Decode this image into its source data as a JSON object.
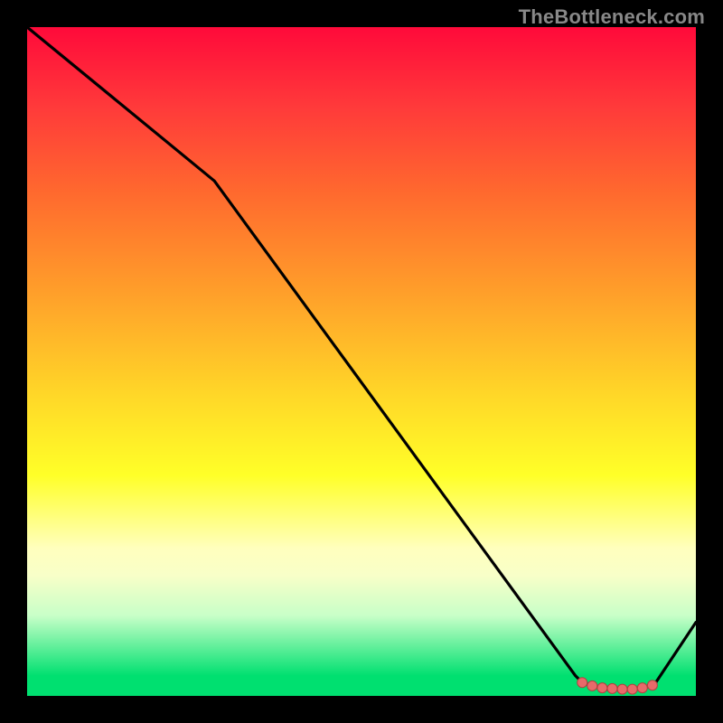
{
  "watermark": "TheBottleneck.com",
  "chart_data": {
    "type": "line",
    "title": "",
    "xlabel": "",
    "ylabel": "",
    "xlim": [
      0,
      100
    ],
    "ylim": [
      0,
      100
    ],
    "series": [
      {
        "name": "curve",
        "x": [
          0,
          28,
          82,
          83,
          86,
          88,
          89,
          91,
          92,
          94,
          100
        ],
        "y": [
          100,
          77,
          3,
          2,
          1,
          1,
          1,
          1,
          1,
          2,
          11
        ]
      }
    ],
    "markers": {
      "name": "bottom-cluster",
      "points": [
        {
          "x": 83,
          "y": 2
        },
        {
          "x": 84.5,
          "y": 1.5
        },
        {
          "x": 86,
          "y": 1.2
        },
        {
          "x": 87.5,
          "y": 1.1
        },
        {
          "x": 89,
          "y": 1.0
        },
        {
          "x": 90.5,
          "y": 1.0
        },
        {
          "x": 92,
          "y": 1.2
        },
        {
          "x": 93.5,
          "y": 1.6
        }
      ]
    },
    "gradient_stops": [
      {
        "pos": 0,
        "color": "#ff0a3a"
      },
      {
        "pos": 12,
        "color": "#ff3a3a"
      },
      {
        "pos": 25,
        "color": "#ff6a2e"
      },
      {
        "pos": 40,
        "color": "#ffa02a"
      },
      {
        "pos": 55,
        "color": "#ffd728"
      },
      {
        "pos": 67,
        "color": "#ffff28"
      },
      {
        "pos": 78,
        "color": "#ffffbe"
      },
      {
        "pos": 88,
        "color": "#c8ffc8"
      },
      {
        "pos": 97,
        "color": "#00e070"
      }
    ]
  }
}
